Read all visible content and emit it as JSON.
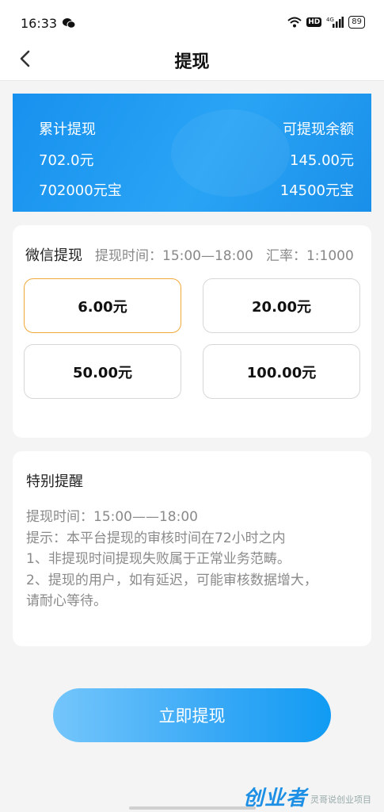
{
  "status_bar": {
    "time": "16:33",
    "hd_label": "HD",
    "network_label": "4G",
    "battery": "89"
  },
  "nav": {
    "title": "提现"
  },
  "balance": {
    "total_label": "累计提现",
    "available_label": "可提现余额",
    "total_yuan": "702.0元",
    "available_yuan": "145.00元",
    "total_bao": "702000元宝",
    "available_bao": "14500元宝"
  },
  "withdraw": {
    "method": "微信提现",
    "time_info": "提现时间：15:00—18:00",
    "rate_info": "汇率：1:1000",
    "amounts": [
      "6.00元",
      "20.00元",
      "50.00元",
      "100.00元"
    ],
    "selected_index": 0
  },
  "notice": {
    "title": "特别提醒",
    "lines": [
      "提现时间：15:00——18:00",
      "提示：本平台提现的审核时间在72小时之内",
      "1、非提现时间提现失败属于正常业务范畴。",
      "2、提现的用户，如有延迟，可能审核数据增大，",
      "请耐心等待。"
    ]
  },
  "submit_label": "立即提现",
  "watermark": {
    "logo": "创业者",
    "sub": "灵哥说创业项目"
  },
  "colors": {
    "card_blue": "#1a93ee",
    "selected_border": "#f0a838",
    "button_start": "#74c6fb",
    "button_end": "#119bf3"
  }
}
